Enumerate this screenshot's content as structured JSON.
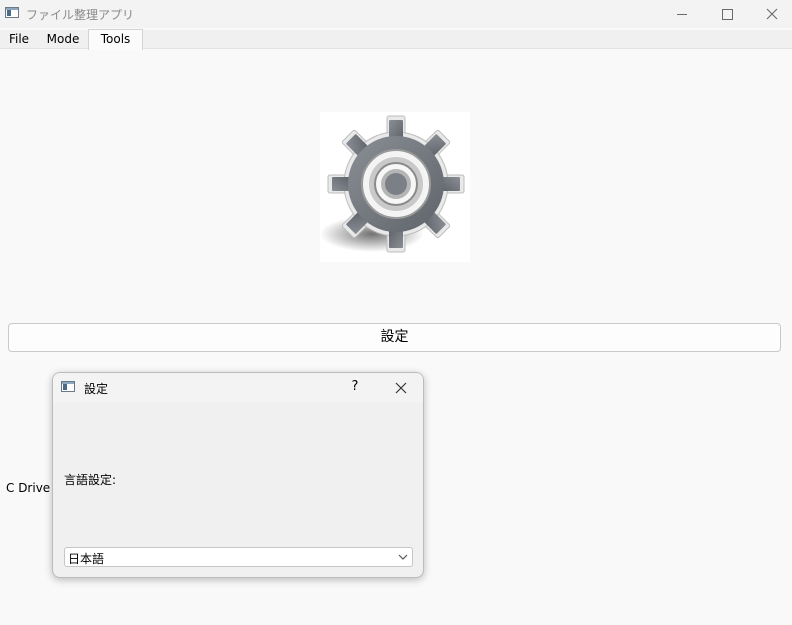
{
  "window": {
    "title": "ファイル整理アプリ",
    "icon": "app-window-icon",
    "controls": [
      "minimize-icon",
      "maximize-icon",
      "close-icon"
    ]
  },
  "tabs": [
    {
      "label": "File",
      "active": false
    },
    {
      "label": "Mode",
      "active": false
    },
    {
      "label": "Tools",
      "active": true
    }
  ],
  "main": {
    "image": "gear-icon",
    "settings_button_label": "設定",
    "drive_label": "C Drive I"
  },
  "dialog": {
    "title": "設定",
    "help_label": "?",
    "language_label": "言語設定:",
    "language_selected": "日本語"
  }
}
